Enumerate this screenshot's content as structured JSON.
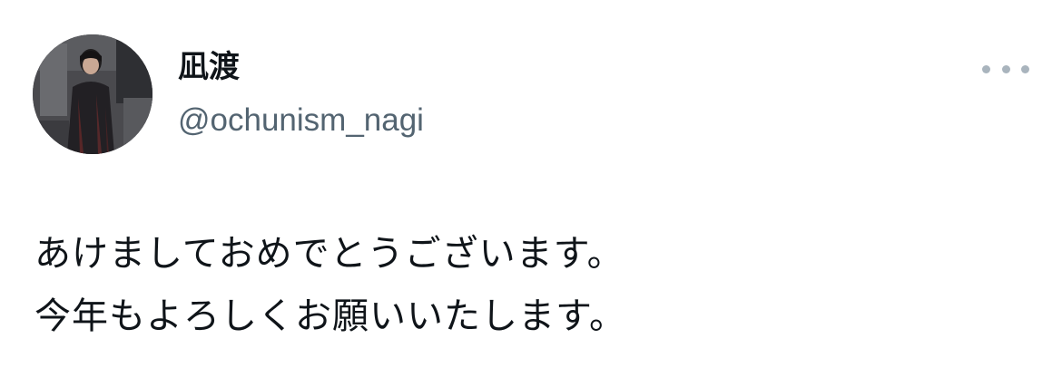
{
  "author": {
    "display_name": "凪渡",
    "handle": "@ochunism_nagi",
    "avatar_icon": "profile-photo"
  },
  "menu": {
    "more_icon": "more-horizontal-icon"
  },
  "tweet": {
    "lines": [
      "あけましておめでとうございます。",
      "今年もよろしくお願いいたします。"
    ]
  },
  "colors": {
    "text_primary": "#0f1419",
    "text_secondary": "#536471",
    "icon_muted": "#a9b4bd",
    "background": "#ffffff"
  }
}
